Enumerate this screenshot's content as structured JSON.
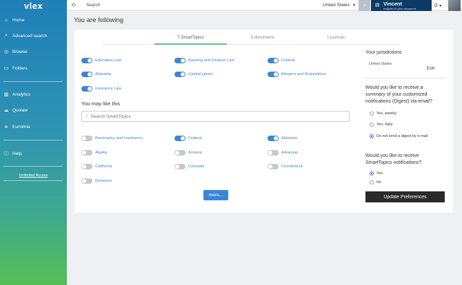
{
  "sidebar": {
    "logo_v": "v",
    "logo_rest": "lex",
    "items": [
      {
        "label": "Home",
        "icon": "home-icon",
        "glyph": "⌂"
      },
      {
        "label": "Advanced search",
        "icon": "search-icon",
        "glyph": "⌕"
      },
      {
        "label": "Browse",
        "icon": "browse-icon",
        "glyph": "◎"
      },
      {
        "label": "Folders",
        "icon": "folder-icon",
        "glyph": "▭"
      },
      {
        "label": "Analytics",
        "icon": "analytics-icon",
        "glyph": "▥"
      },
      {
        "label": "Quolaw",
        "icon": "cloud-icon",
        "glyph": "☁"
      },
      {
        "label": "Eunomia",
        "icon": "bulb-icon",
        "glyph": "●"
      },
      {
        "label": "Help",
        "icon": "help-icon",
        "glyph": "ⓘ"
      }
    ],
    "unlimited_access": "Unlimited Access"
  },
  "header": {
    "search_placeholder": "Search",
    "country": "United States",
    "user_name": "Vincent",
    "user_subtitle": "Insights on your document",
    "counter": "0"
  },
  "page": {
    "title": "You are following"
  },
  "tabs": [
    {
      "label": "7 SmartTopics",
      "active": true
    },
    {
      "label": "5 documents",
      "active": false
    },
    {
      "label": "1 journals",
      "active": false
    }
  ],
  "following": [
    {
      "label": "Education Law",
      "on": true
    },
    {
      "label": "Banking and Finance Law",
      "on": true
    },
    {
      "label": "Federal",
      "on": true
    },
    {
      "label": "Alabama",
      "on": true
    },
    {
      "label": "Capital arkets",
      "on": true
    },
    {
      "label": "Mergers and Acquisitions",
      "on": true
    },
    {
      "label": "Insurance Law",
      "on": true
    }
  ],
  "may_like": {
    "heading": "You may like this",
    "search_placeholder": "Search SmartTopics",
    "items": [
      {
        "label": "Bankruptcy and Insolvency",
        "on": false
      },
      {
        "label": "Federal",
        "on": true
      },
      {
        "label": "Alabama",
        "on": true
      },
      {
        "label": "Alaska",
        "on": false
      },
      {
        "label": "Arizona",
        "on": false
      },
      {
        "label": "Arkansas",
        "on": false
      },
      {
        "label": "California",
        "on": false
      },
      {
        "label": "Colorado",
        "on": false
      },
      {
        "label": "Connecticut",
        "on": false
      },
      {
        "label": "Delaware",
        "on": false
      }
    ],
    "more_label": "more..."
  },
  "right_panel": {
    "jurisdictions_heading": "Your jurisdictions",
    "jurisdiction_country": "United States",
    "edit_label": "Edit",
    "digest_question_l1": "Would you like to receive a",
    "digest_question_l2": "summary of your customized",
    "digest_question_l3": "notifications (Digest) via email?",
    "digest_options": [
      {
        "label": "Yes, weekly",
        "checked": false
      },
      {
        "label": "Yes, daily",
        "checked": false
      },
      {
        "label": "Do not send a digest by e-mail",
        "checked": true
      }
    ],
    "smart_question_l1": "Would you like to receive",
    "smart_question_l2": "SmartTopics notifications?",
    "smart_options": [
      {
        "label": "Yes",
        "checked": true
      },
      {
        "label": "No",
        "checked": false
      }
    ],
    "update_label": "Update Preferences"
  }
}
